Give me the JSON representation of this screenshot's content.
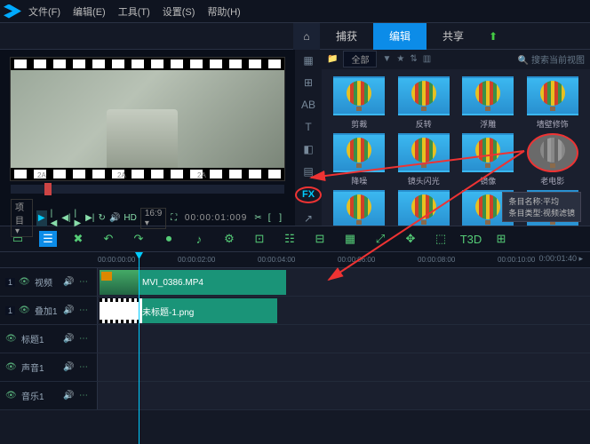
{
  "menu": {
    "file": "文件(F)",
    "edit": "编辑(E)",
    "tools": "工具(T)",
    "settings": "设置(S)",
    "help": "帮助(H)"
  },
  "tabs": {
    "capture": "捕获",
    "edit": "编辑",
    "share": "共享"
  },
  "preview": {
    "project": "项目 ▾",
    "hd": "HD",
    "ratio": "16:9 ▾",
    "timecode": "00:00:01:009",
    "frameLabels": [
      "2A",
      "2A",
      "2A",
      "2A",
      "2A",
      "2A",
      "2A"
    ]
  },
  "fx_label": "FX",
  "library": {
    "dropdown": "全部",
    "search": "搜索当前视图",
    "items": [
      {
        "label": "剪裁"
      },
      {
        "label": "反转"
      },
      {
        "label": "浮雕"
      },
      {
        "label": "墙壁修饰"
      },
      {
        "label": "降噪"
      },
      {
        "label": "镜头闪光"
      },
      {
        "label": "镜像"
      },
      {
        "label": "老电影",
        "grey": true,
        "sel": true
      },
      {
        "label": ""
      },
      {
        "label": ""
      },
      {
        "label": ""
      },
      {
        "label": ""
      }
    ],
    "tooltip": {
      "l1": "条目名称:平均",
      "l2": "条目类型:视频滤镜"
    }
  },
  "timeline": {
    "ticks": [
      "00:00:00:00",
      "00:00:02:00",
      "00:00:04:00",
      "00:00:06:00",
      "00:00:08:00",
      "00:00:10:00"
    ],
    "rightTc": "0:00:01:40 ▸",
    "tracks": [
      {
        "name": "视频",
        "soloNum": "1"
      },
      {
        "name": "叠加1",
        "soloNum": "1"
      },
      {
        "name": "标题1"
      },
      {
        "name": "声音1"
      },
      {
        "name": "音乐1"
      }
    ],
    "clips": {
      "video": "MVI_0386.MP4",
      "overlay": "未标题-1.png"
    }
  }
}
